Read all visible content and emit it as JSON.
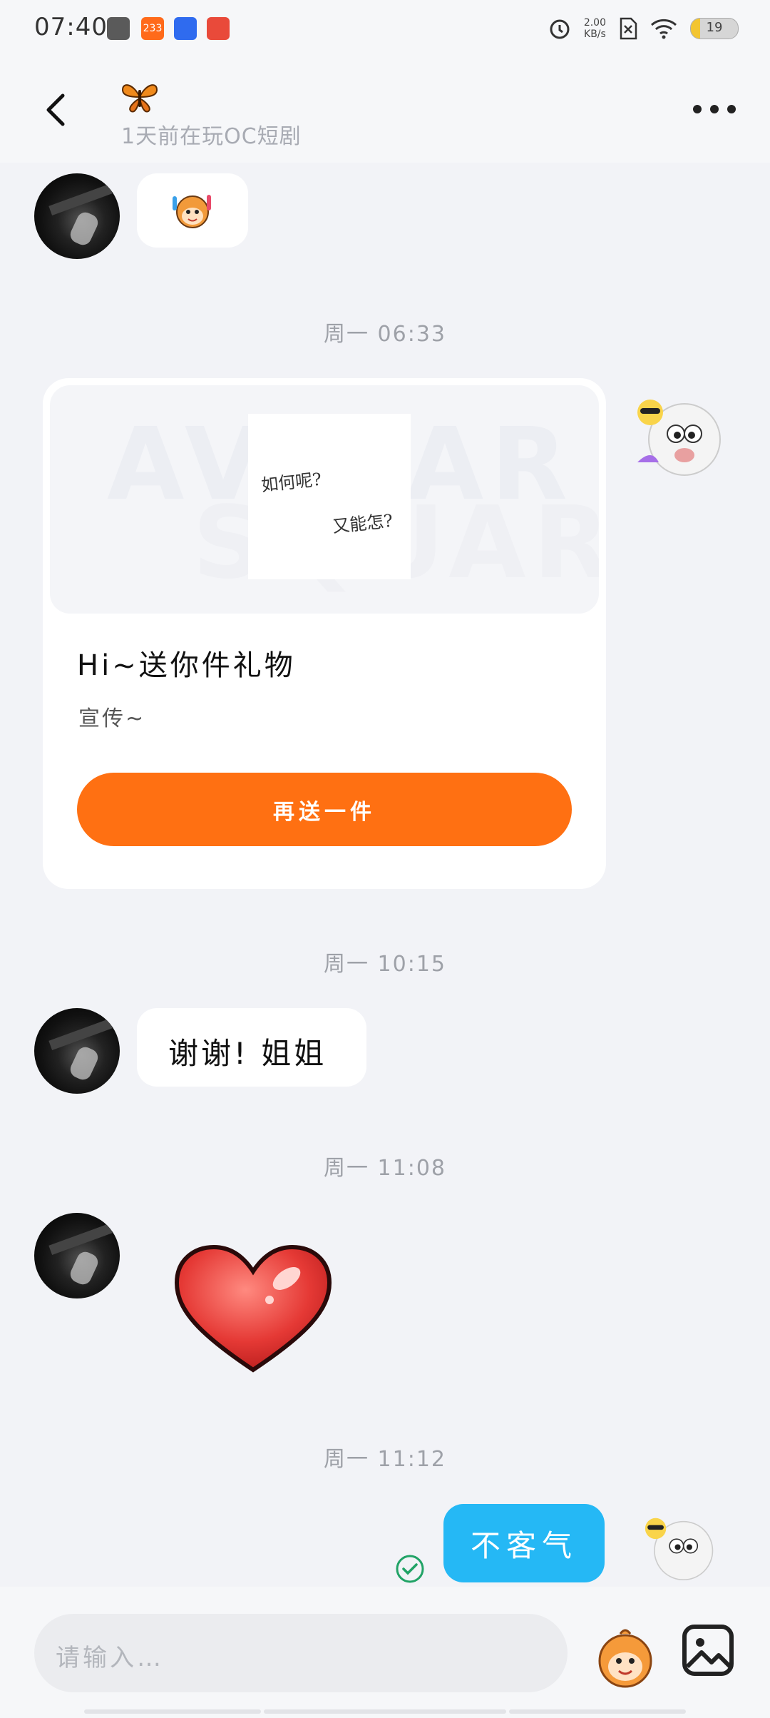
{
  "status_bar": {
    "time": "07:40",
    "app_badge": "233",
    "net_speed_value": "2.00",
    "net_speed_unit": "KB/s",
    "battery": "19"
  },
  "header": {
    "subtitle": "1天前在玩OC短剧"
  },
  "messages": {
    "ts1": "周一 06:33",
    "card_overlay_1": "如何呢?",
    "card_overlay_2": "又能怎?",
    "card_bg_1": "AVATAR",
    "card_bg_2": "SQUARE",
    "card_title": "Hi~送你件礼物",
    "card_subtitle": "宣传~",
    "card_button": "再送一件",
    "ts2": "周一 10:15",
    "reply1": "谢谢! 姐姐",
    "ts3": "周一 11:08",
    "ts4": "周一 11:12",
    "my_reply": "不客气"
  },
  "input": {
    "placeholder": "请输入…"
  },
  "colors": {
    "accent_orange": "#ff7012",
    "bubble_blue": "#25b8f5",
    "background": "#f2f3f7"
  },
  "icons": [
    "back-arrow-icon",
    "butterfly-icon",
    "more-dots-icon",
    "check-circle-icon",
    "emoji-monkey-icon",
    "image-icon",
    "heart-sticker"
  ]
}
